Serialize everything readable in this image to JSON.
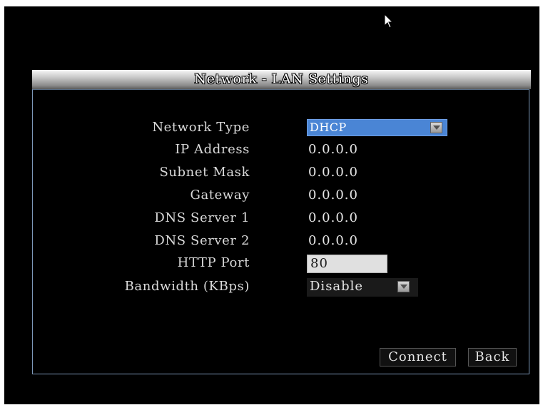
{
  "window": {
    "title": "Network - LAN Settings"
  },
  "form": {
    "network_type": {
      "label": "Network Type",
      "value": "DHCP"
    },
    "ip_address": {
      "label": "IP Address",
      "value": "0.0.0.0"
    },
    "subnet_mask": {
      "label": "Subnet Mask",
      "value": "0.0.0.0"
    },
    "gateway": {
      "label": "Gateway",
      "value": "0.0.0.0"
    },
    "dns_server_1": {
      "label": "DNS Server 1",
      "value": "0.0.0.0"
    },
    "dns_server_2": {
      "label": "DNS Server 2",
      "value": "0.0.0.0"
    },
    "http_port": {
      "label": "HTTP Port",
      "value": "80"
    },
    "bandwidth": {
      "label": "Bandwidth (KBps)",
      "value": "Disable"
    }
  },
  "buttons": {
    "connect": "Connect",
    "back": "Back"
  },
  "icons": {
    "cursor": "mouse-pointer-icon",
    "dropdown": "chevron-down-icon"
  },
  "colors": {
    "background": "#000000",
    "selected_field": "#4a85d5",
    "panel_border": "#7d98b8"
  }
}
